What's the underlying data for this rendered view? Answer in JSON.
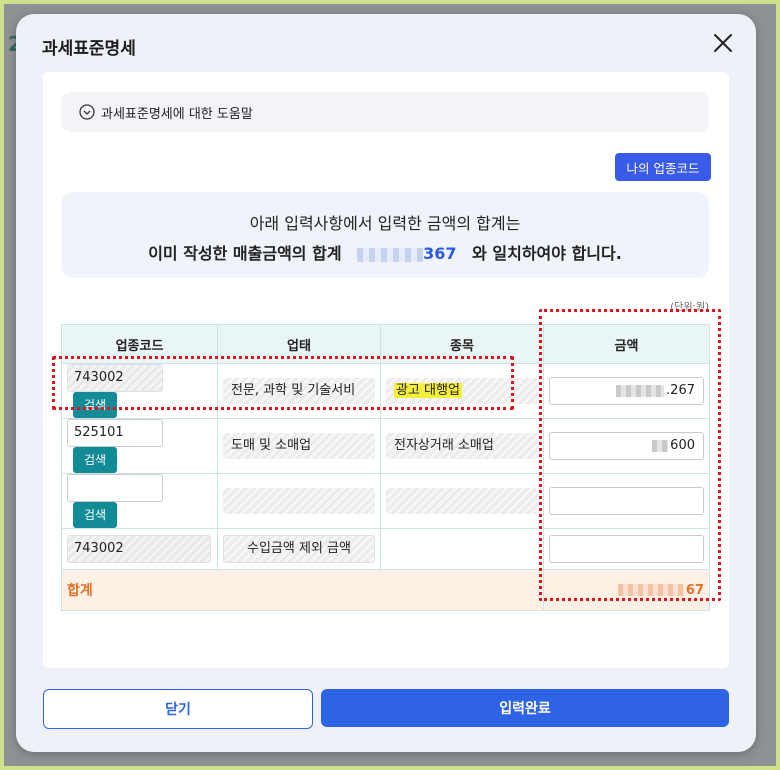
{
  "modal": {
    "title": "과세표준명세",
    "help_text": "과세표준명세에 대한 도움말",
    "my_code_button": "나의 업종코드",
    "notice_line1": "아래 입력사항에서 입력한 금액의 합계는",
    "notice_line2_prefix": "이미 작성한 매출금액의 합계",
    "notice_amount_suffix": "367",
    "notice_line2_suffix": "와 일치하여야 합니다.",
    "unit": "(단위:원)",
    "close_label": "닫기",
    "submit_label": "입력완료"
  },
  "table": {
    "headers": [
      "업종코드",
      "업태",
      "종목",
      "금액"
    ],
    "search_label": "검색",
    "rows": [
      {
        "code": "743002",
        "type": "전문, 과학 및 기술서비",
        "item": "광고 대행업",
        "amount_suffix": ".267"
      },
      {
        "code": "525101",
        "type": "도매 및 소매업",
        "item": "전자상거래 소매업",
        "amount_suffix": "600"
      },
      {
        "code": "",
        "type": "",
        "item": "",
        "amount_suffix": ""
      },
      {
        "code": "743002",
        "type": "수입금액 제외 금액",
        "item": "",
        "amount_suffix": ""
      }
    ],
    "total_label": "합계",
    "total_suffix": "67"
  },
  "colors": {
    "accent": "#2e63e6",
    "teal": "#128b96",
    "total_orange": "#e5712b",
    "highlight": "#e0141b"
  },
  "background": {
    "fragment": "2"
  }
}
